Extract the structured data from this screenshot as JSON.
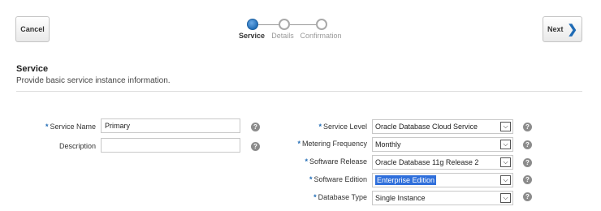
{
  "header": {
    "cancel_label": "Cancel",
    "next_label": "Next",
    "next_icon": "chevron-right-icon"
  },
  "train": {
    "steps": [
      {
        "label": "Service",
        "state": "current"
      },
      {
        "label": "Details",
        "state": "future"
      },
      {
        "label": "Confirmation",
        "state": "future"
      }
    ]
  },
  "section": {
    "title": "Service",
    "description": "Provide basic service instance information."
  },
  "form": {
    "required_marker": "*",
    "service_name": {
      "label": "Service Name",
      "value": "Primary",
      "required": true
    },
    "description": {
      "label": "Description",
      "value": "",
      "required": false
    },
    "service_level": {
      "label": "Service Level",
      "value": "Oracle Database Cloud Service",
      "required": true
    },
    "metering_frequency": {
      "label": "Metering Frequency",
      "value": "Monthly",
      "required": true
    },
    "software_release": {
      "label": "Software Release",
      "value": "Oracle Database 11g Release 2",
      "required": true
    },
    "software_edition": {
      "label": "Software Edition",
      "value": "Enterprise Edition",
      "required": true
    },
    "database_type": {
      "label": "Database Type",
      "value": "Single Instance",
      "required": true
    }
  },
  "icons": {
    "help": "help-icon",
    "dropdown": "dropdown-arrow-icon"
  },
  "colors": {
    "accent": "#1f6bb5",
    "selection": "#2f6fdb",
    "help_icon": "#8c8c8c"
  }
}
